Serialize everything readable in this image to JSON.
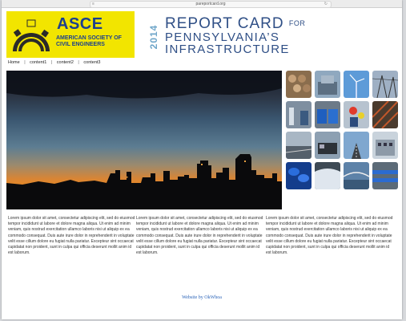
{
  "browser": {
    "url": "pareportcard.org"
  },
  "logo": {
    "acronym": "ASCE",
    "name": "AMERICAN SOCIETY OF CIVIL ENGINEERS",
    "bg_color": "#f2e500",
    "text_color": "#1b3f8f"
  },
  "header": {
    "year": "2014",
    "title": "REPORT CARD",
    "title_suffix": "FOR",
    "subtitle_line1": "PENNSYLVANIA’S",
    "subtitle_line2": "INFRASTRUCTURE",
    "title_color": "#2f4f86",
    "year_color": "#6fa6c9"
  },
  "nav": {
    "items": [
      "Home",
      "content1",
      "content2",
      "content3"
    ]
  },
  "hero": {
    "image": "city-skyline-at-sunset"
  },
  "thumbnails": [
    "stacked-pipes",
    "water-treatment-tank",
    "wind-turbine",
    "power-lines",
    "bridge-lift",
    "blue-generators",
    "hard-hat-workers",
    "steel-structure",
    "rail-yard",
    "locomotive",
    "road-highway",
    "school-building",
    "blue-barrels",
    "dam-spillway",
    "river-bridge",
    "blue-pipes"
  ],
  "columns": [
    "Lorem ipsum dolor sit amet, consectetur adipiscing elit, sed do eiusmod tempor incididunt ut labore et dolore magna aliqua. Ut enim ad minim veniam, quis nostrud exercitation ullamco laboris nisi ut aliquip ex ea commodo consequat. Duis aute irure dolor in reprehenderit in voluptate velit esse cillum dolore eu fugiat nulla pariatur. Excepteur sint occaecat cupidatat non proident, sunt in culpa qui officia deserunt mollit anim id est laborum.",
    "Lorem ipsum dolor sit amet, consectetur adipiscing elit, sed do eiusmod tempor incididunt ut labore et dolore magna aliqua. Ut enim ad minim veniam, quis nostrud exercitation ullamco laboris nisi ut aliquip ex ea commodo consequat. Duis aute irure dolor in reprehenderit in voluptate velit esse cillum dolore eu fugiat nulla pariatur. Excepteur sint occaecat cupidatat non proident, sunt in culpa qui officia deserunt mollit anim id est laborum.",
    "Lorem ipsum dolor sit amet, consectetur adipiscing elit, sed do eiusmod tempor incididunt ut labore et dolore magna aliqua. Ut enim ad minim veniam, quis nostrud exercitation ullamco laboris nisi ut aliquip ex ea commodo consequat. Duis aute irure dolor in reprehenderit in voluptate velit esse cillum dolore eu fugiat nulla pariatur. Excepteur sint occaecat cupidatat non proident, sunt in culpa qui officia deserunt mollit anim id est laborum."
  ],
  "footer": {
    "link_text": "Website by OkWhoa",
    "link_color": "#2a63b8"
  }
}
